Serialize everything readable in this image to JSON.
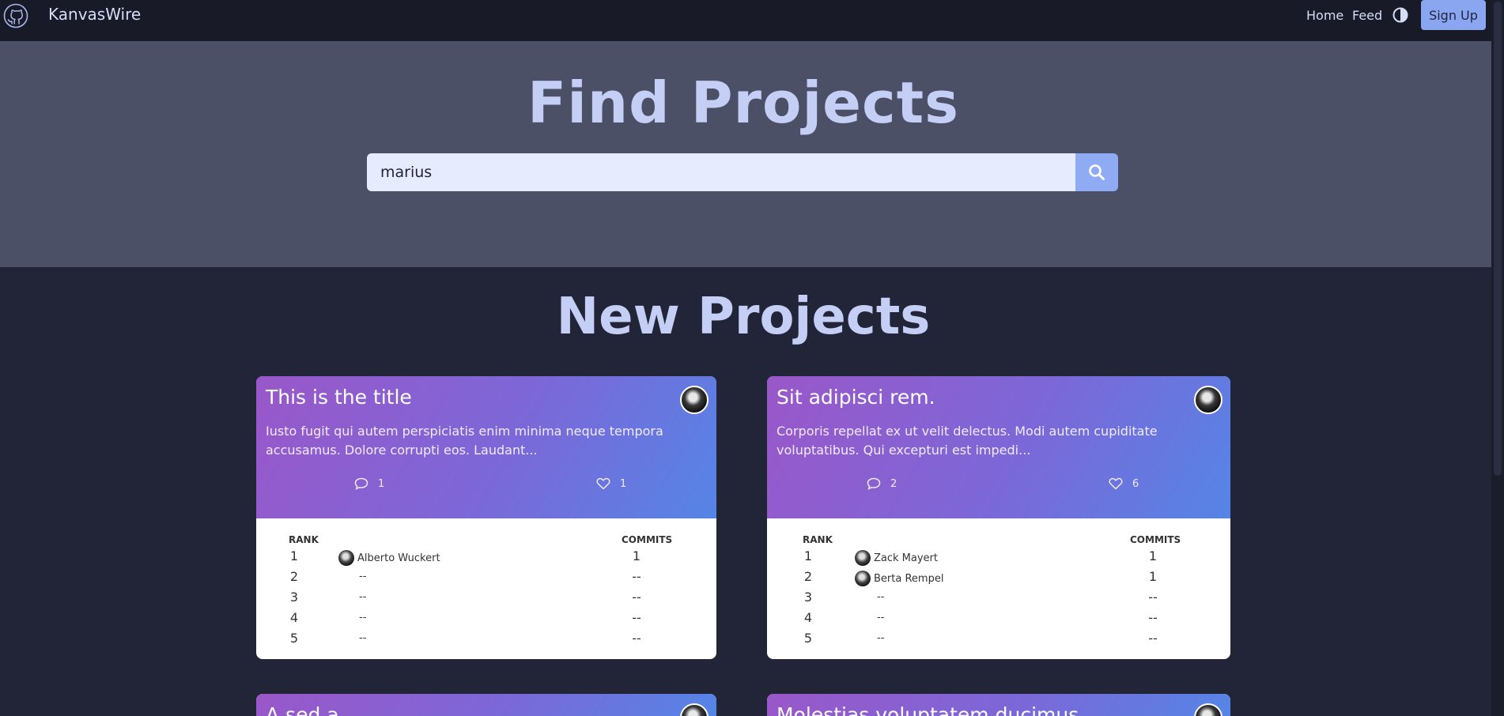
{
  "nav": {
    "brand": "KanvasWire",
    "home": "Home",
    "feed": "Feed",
    "signup": "Sign Up"
  },
  "hero": {
    "title": "Find Projects",
    "search_value": "marius"
  },
  "section": {
    "title": "New Projects"
  },
  "table_headers": {
    "rank": "RANK",
    "commits": "COMMITS"
  },
  "cards": [
    {
      "title": "This is the title",
      "description": "Iusto fugit qui autem perspiciatis enim minima neque tempora accusamus. Dolore corrupti eos. Laudant...",
      "comments": "1",
      "likes": "1",
      "rows": [
        {
          "rank": "1",
          "user": "Alberto Wuckert",
          "commits": "1",
          "has_avatar": true
        },
        {
          "rank": "2",
          "user": "--",
          "commits": "--",
          "has_avatar": false
        },
        {
          "rank": "3",
          "user": "--",
          "commits": "--",
          "has_avatar": false
        },
        {
          "rank": "4",
          "user": "--",
          "commits": "--",
          "has_avatar": false
        },
        {
          "rank": "5",
          "user": "--",
          "commits": "--",
          "has_avatar": false
        }
      ]
    },
    {
      "title": "Sit adipisci rem.",
      "description": "Corporis repellat ex ut velit delectus. Modi autem cupiditate voluptatibus. Qui excepturi est impedi...",
      "comments": "2",
      "likes": "6",
      "rows": [
        {
          "rank": "1",
          "user": "Zack Mayert",
          "commits": "1",
          "has_avatar": true
        },
        {
          "rank": "2",
          "user": "Berta Rempel",
          "commits": "1",
          "has_avatar": true
        },
        {
          "rank": "3",
          "user": "--",
          "commits": "--",
          "has_avatar": false
        },
        {
          "rank": "4",
          "user": "--",
          "commits": "--",
          "has_avatar": false
        },
        {
          "rank": "5",
          "user": "--",
          "commits": "--",
          "has_avatar": false
        }
      ]
    },
    {
      "title": "A sed a."
    },
    {
      "title": "Molestias voluptatem ducimus."
    }
  ]
}
